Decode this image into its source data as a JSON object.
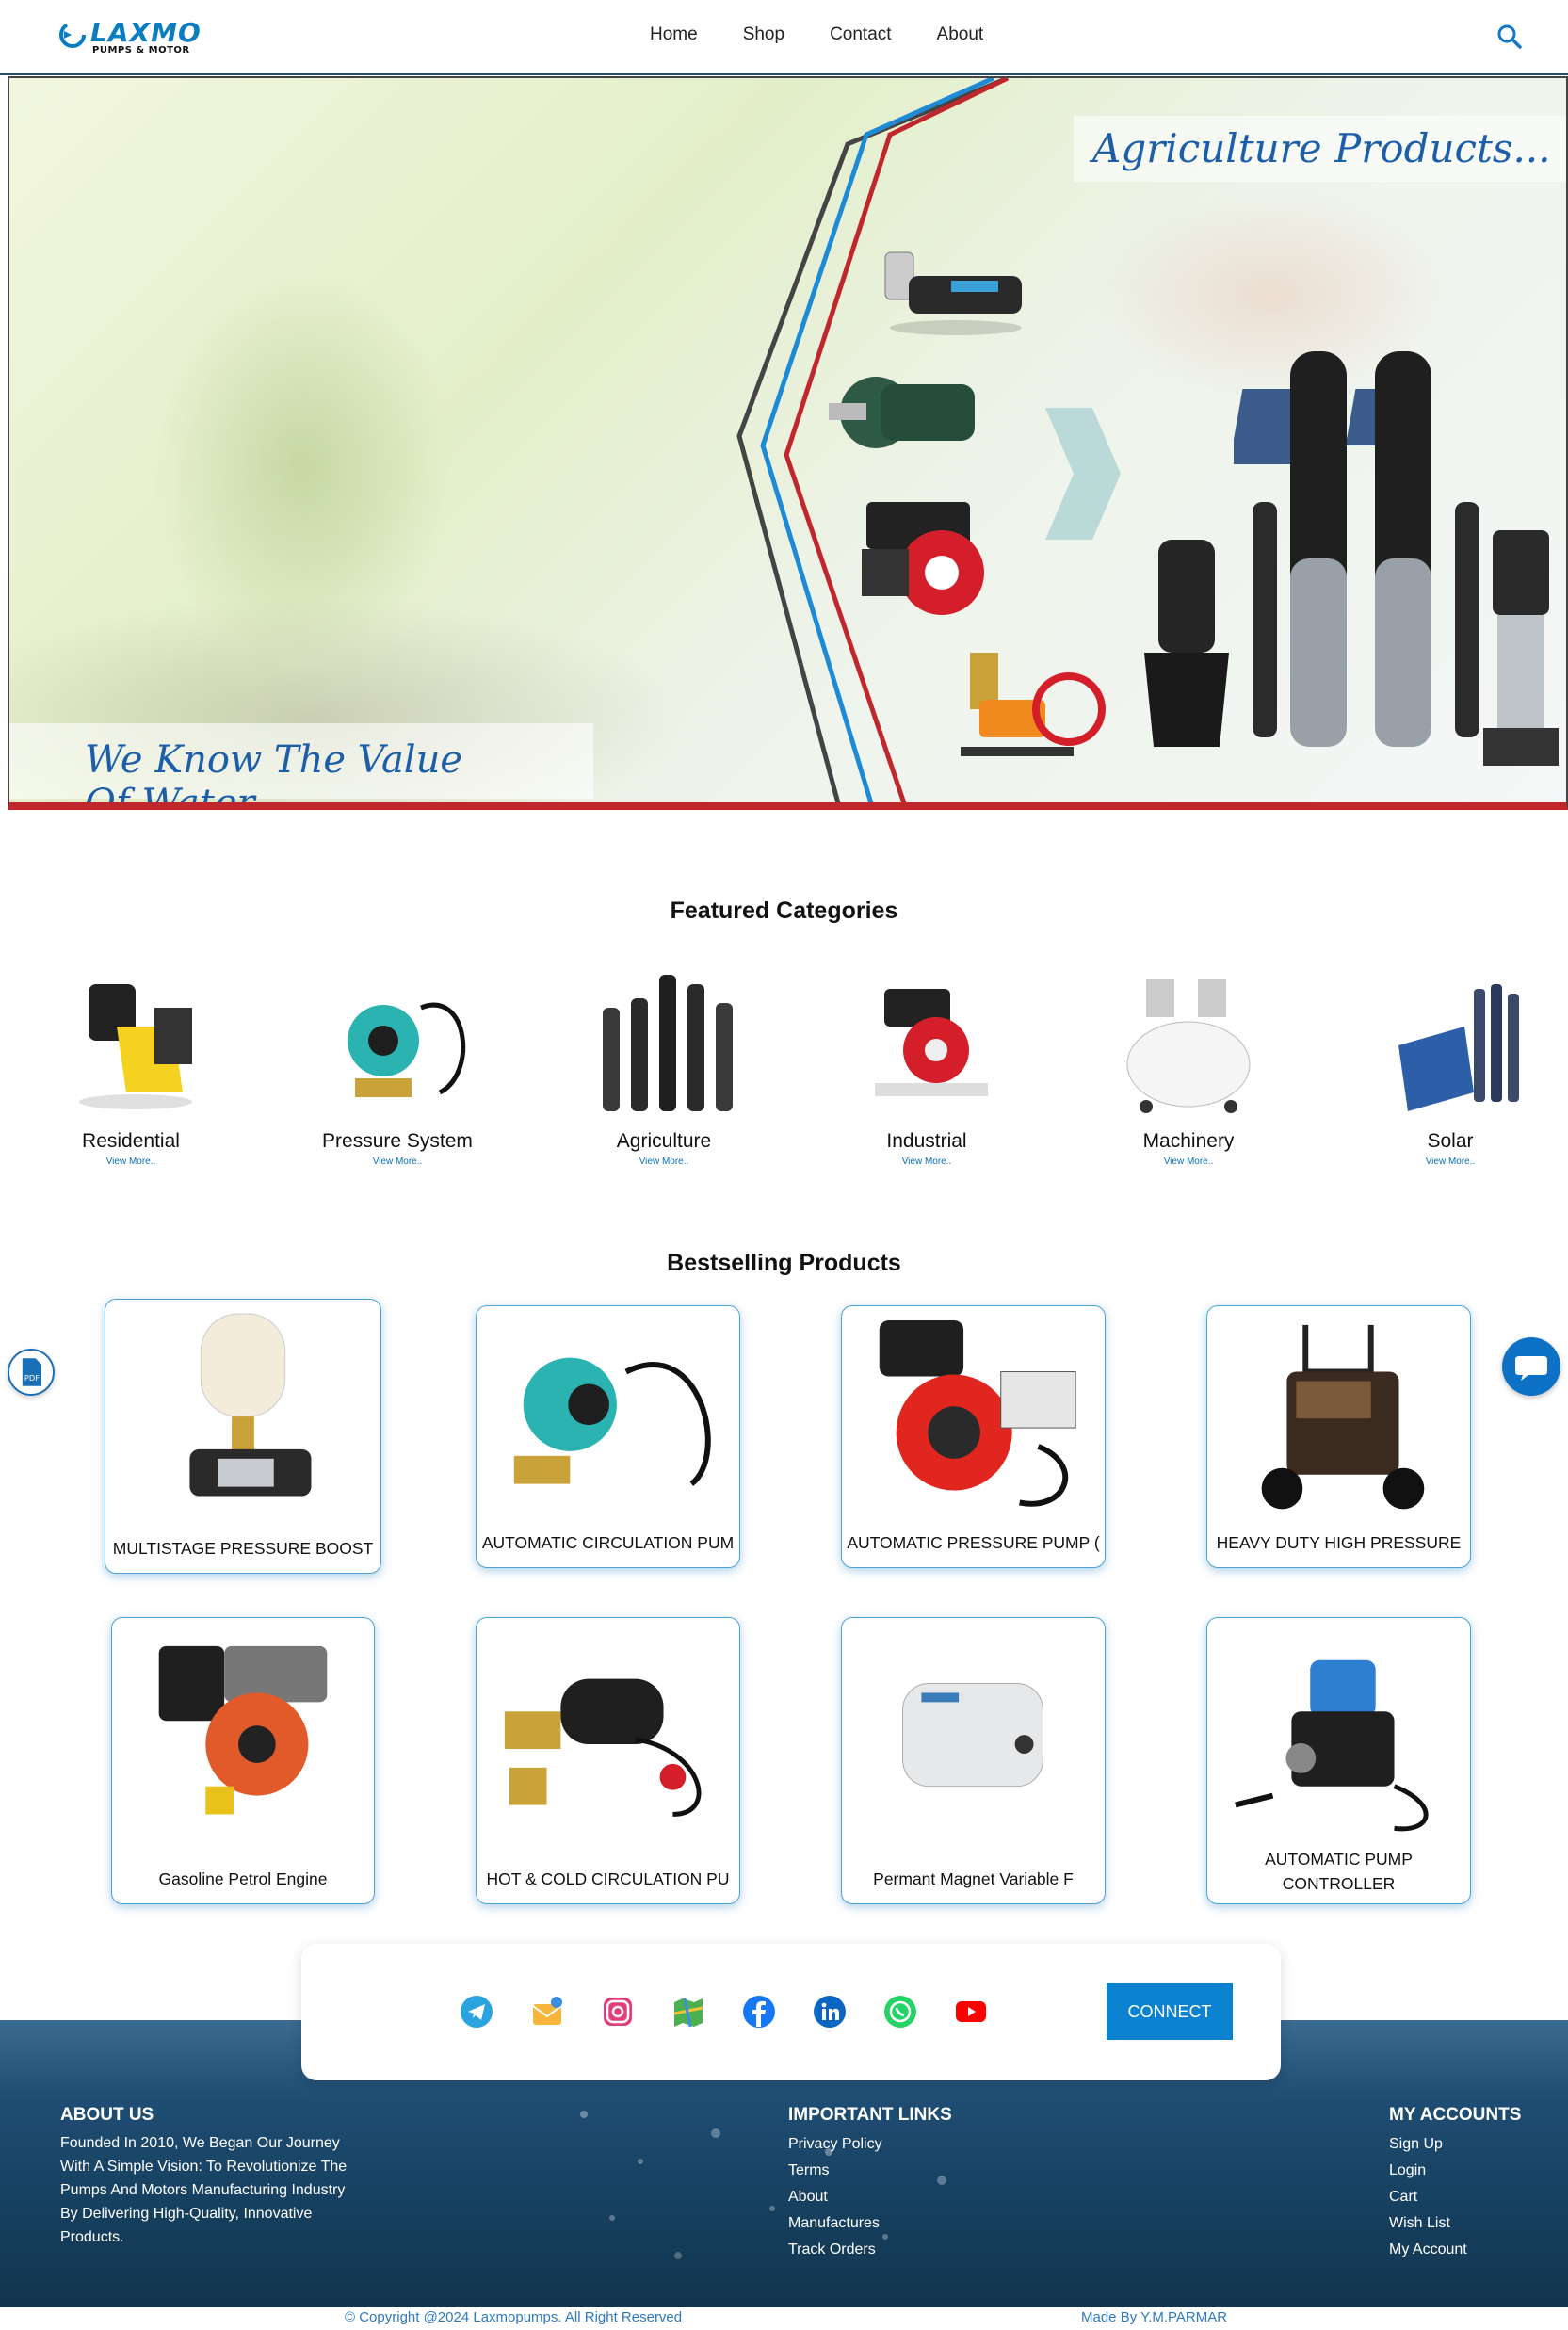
{
  "header": {
    "brand": "LAXMO",
    "brand_sub": "PUMPS & MOTOR",
    "nav": [
      "Home",
      "Shop",
      "Contact",
      "About"
    ],
    "search_icon": "search-icon"
  },
  "hero": {
    "title": "Agriculture Products...",
    "tagline": "We Know The Value Of Water"
  },
  "categories": {
    "title": "Featured Categories",
    "items": [
      {
        "label": "Residential",
        "link": "View More.."
      },
      {
        "label": "Pressure System",
        "link": "View More.."
      },
      {
        "label": "Agriculture",
        "link": "View More.."
      },
      {
        "label": "Industrial",
        "link": "View More.."
      },
      {
        "label": "Machinery",
        "link": "View More.."
      },
      {
        "label": "Solar",
        "link": "View More.."
      }
    ]
  },
  "products": {
    "title": "Bestselling Products",
    "items": [
      {
        "name": "MULTISTAGE PRESSURE BOOST"
      },
      {
        "name": "AUTOMATIC CIRCULATION PUM"
      },
      {
        "name": "AUTOMATIC PRESSURE PUMP ("
      },
      {
        "name": "HEAVY DUTY HIGH PRESSURE"
      },
      {
        "name": "Gasoline Petrol Engine"
      },
      {
        "name": "HOT & COLD CIRCULATION PU"
      },
      {
        "name": "Permant Magnet Variable F"
      },
      {
        "name": "AUTOMATIC PUMP CONTROLLER"
      }
    ]
  },
  "social": {
    "icons": [
      "telegram-icon",
      "email-icon",
      "instagram-icon",
      "map-icon",
      "facebook-icon",
      "linkedin-icon",
      "whatsapp-icon",
      "youtube-icon"
    ],
    "connect_label": "CONNECT"
  },
  "footer": {
    "about_title": "ABOUT US",
    "about_text": "Founded In 2010, We Began Our Journey With A Simple Vision: To Revolutionize The Pumps And Motors Manufacturing Industry By Delivering High-Quality, Innovative Products.",
    "links_title": "IMPORTANT LINKS",
    "links": [
      "Privacy Policy",
      "Terms",
      "About",
      "Manufactures",
      "Track Orders"
    ],
    "accounts_title": "MY ACCOUNTS",
    "accounts": [
      "Sign Up",
      "Login",
      "Cart",
      "Wish List",
      "My Account"
    ],
    "copyright": "© Copyright @2024 Laxmopumps. All Right Reserved",
    "made_by": "Made By Y.M.PARMAR"
  },
  "colors": {
    "brand_blue": "#0a7cc2",
    "connect_bg": "#0a82cf",
    "hero_border_red": "#c0272d"
  }
}
